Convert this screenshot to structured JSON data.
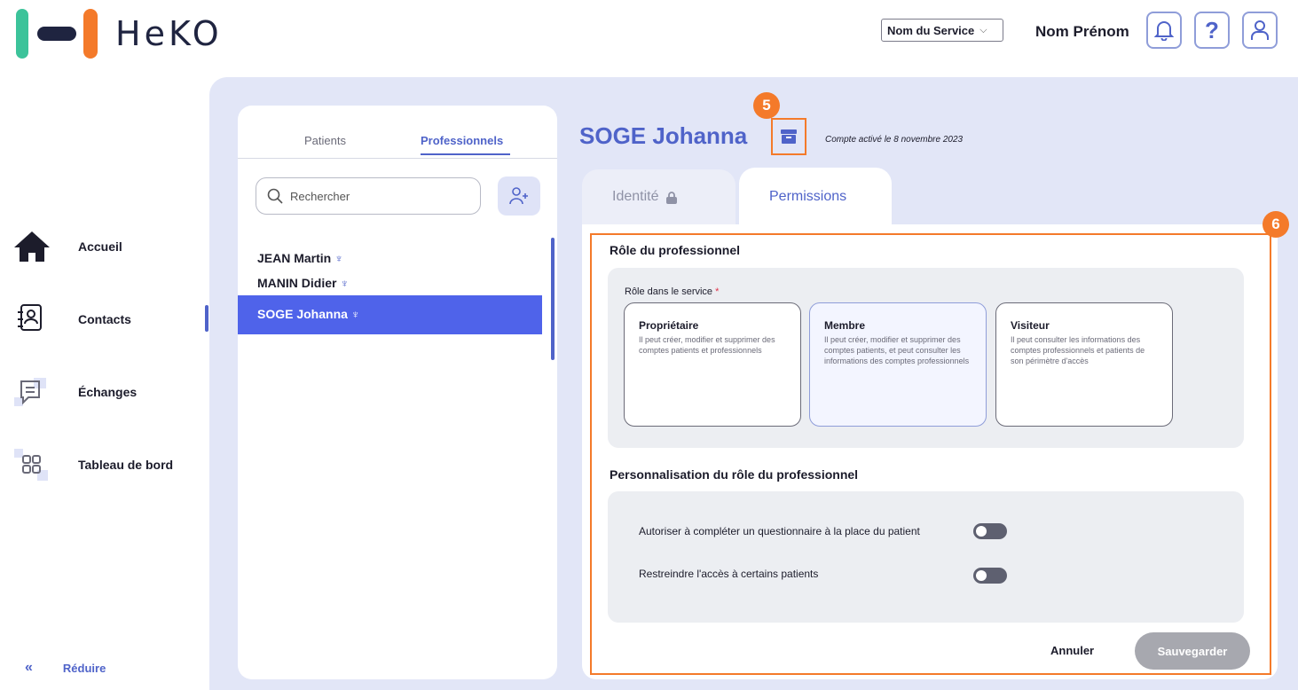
{
  "header": {
    "logo_text": "HeKO",
    "service_select": "Nom du Service",
    "user_name": "Nom Prénom"
  },
  "sidebar": {
    "items": [
      {
        "label": "Accueil",
        "icon": "home-icon"
      },
      {
        "label": "Contacts",
        "icon": "contacts-icon"
      },
      {
        "label": "Échanges",
        "icon": "messages-icon"
      },
      {
        "label": "Tableau de bord",
        "icon": "dashboard-icon"
      }
    ],
    "active": "Contacts",
    "reduce_label": "Réduire"
  },
  "contacts": {
    "tabs": [
      "Patients",
      "Professionnels"
    ],
    "active_tab": "Professionnels",
    "search_placeholder": "Rechercher",
    "people": [
      {
        "name": "JEAN Martin"
      },
      {
        "name": "MANIN Didier"
      },
      {
        "name": "SOGE Johanna",
        "selected": true
      }
    ]
  },
  "detail": {
    "name": "SOGE Johanna",
    "annotation_5": "5",
    "activated_text": "Compte activé le 8 novembre 2023",
    "tabs": {
      "identity": "Identité",
      "permissions": "Permissions"
    },
    "annotation_6": "6",
    "role_section_title": "Rôle du professionnel",
    "role_label": "Rôle dans le service",
    "required_mark": "*",
    "roles": [
      {
        "title": "Propriétaire",
        "desc": "Il peut créer, modifier et supprimer des comptes patients et professionnels"
      },
      {
        "title": "Membre",
        "desc": "Il peut créer, modifier et supprimer des comptes patients, et peut consulter les informations des comptes professionnels",
        "selected": true
      },
      {
        "title": "Visiteur",
        "desc": "Il peut consulter les informations des comptes professionnels et patients de son périmètre d'accès"
      }
    ],
    "custom_section_title": "Personnalisation du rôle du professionnel",
    "toggles": [
      {
        "label": "Autoriser à compléter un questionnaire à la place du patient",
        "on": false
      },
      {
        "label": "Restreindre l'accès à certains patients",
        "on": false
      }
    ],
    "cancel_label": "Annuler",
    "save_label": "Sauvegarder"
  },
  "colors": {
    "accent": "#4f63c9",
    "highlight": "#f47a2a",
    "panel_bg": "#e2e6f7"
  }
}
